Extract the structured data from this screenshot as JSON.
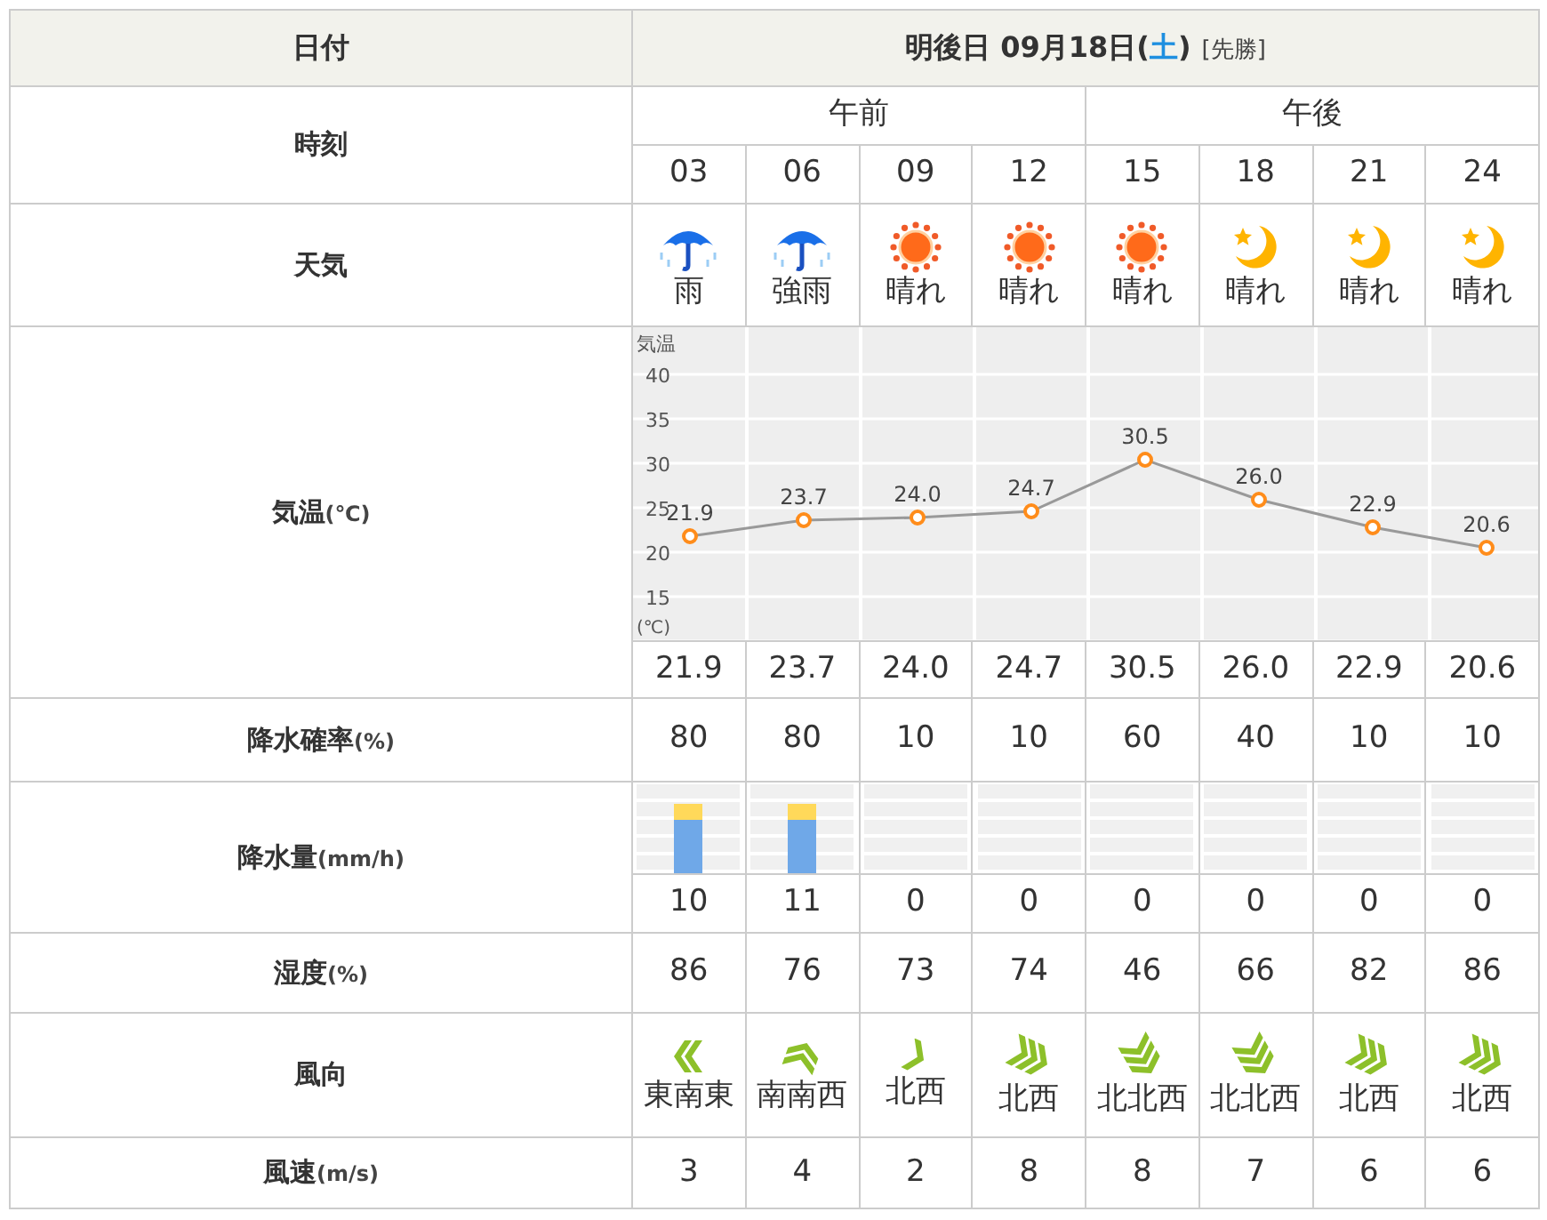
{
  "header": {
    "label": "日付",
    "date": "明後日 09月18日(",
    "weekday": "土",
    "date_end": ")",
    "rokuyo": "[先勝]"
  },
  "time_label": "時刻",
  "periods": [
    "午前",
    "午後"
  ],
  "hours": [
    "03",
    "06",
    "09",
    "12",
    "15",
    "18",
    "21",
    "24"
  ],
  "weather_label": "天気",
  "weather": [
    {
      "kind": "rain",
      "text": "雨"
    },
    {
      "kind": "rain",
      "text": "強雨"
    },
    {
      "kind": "sun",
      "text": "晴れ"
    },
    {
      "kind": "sun",
      "text": "晴れ"
    },
    {
      "kind": "sun",
      "text": "晴れ"
    },
    {
      "kind": "moon",
      "text": "晴れ"
    },
    {
      "kind": "moon",
      "text": "晴れ"
    },
    {
      "kind": "moon",
      "text": "晴れ"
    }
  ],
  "temperature": {
    "label": "気温",
    "unit": "(℃)",
    "chart_data": {
      "type": "line",
      "ylabel": "気温",
      "annotations": [
        "(℃)"
      ],
      "ylim": [
        10,
        45
      ],
      "yticks": [
        15,
        20,
        25,
        30,
        35,
        40
      ],
      "grid": true,
      "value_labels": [
        "21.9",
        "23.7",
        "24.0",
        "24.7",
        "30.5",
        "26.0",
        "22.9",
        "20.6"
      ],
      "series": [
        {
          "color": "#ff8c1a",
          "marker": "circle",
          "values": [
            21.9,
            23.7,
            24.0,
            24.7,
            30.5,
            26.0,
            22.9,
            20.6
          ]
        }
      ]
    },
    "values": [
      "21.9",
      "23.7",
      "24.0",
      "24.7",
      "30.5",
      "26.0",
      "22.9",
      "20.6"
    ]
  },
  "precip_prob": {
    "label": "降水確率",
    "unit": "(%)",
    "values": [
      "80",
      "80",
      "10",
      "10",
      "60",
      "40",
      "10",
      "10"
    ]
  },
  "precip_amount": {
    "label": "降水量",
    "unit": "(mm/h)",
    "values": [
      "10",
      "11",
      "0",
      "0",
      "0",
      "0",
      "0",
      "0"
    ]
  },
  "humidity": {
    "label": "湿度",
    "unit": "(%)",
    "values": [
      "86",
      "76",
      "73",
      "74",
      "46",
      "66",
      "82",
      "86"
    ]
  },
  "wind_direction": {
    "label": "風向",
    "items": [
      {
        "kind": "ese2",
        "text": "東南東"
      },
      {
        "kind": "ssw2",
        "text": "南南西"
      },
      {
        "kind": "nw1",
        "text": "北西"
      },
      {
        "kind": "nw3",
        "text": "北西"
      },
      {
        "kind": "nnw3",
        "text": "北北西"
      },
      {
        "kind": "nnw3",
        "text": "北北西"
      },
      {
        "kind": "nw3",
        "text": "北西"
      },
      {
        "kind": "nw3",
        "text": "北西"
      }
    ]
  },
  "wind_speed": {
    "label": "風速",
    "unit": "(m/s)",
    "values": [
      "3",
      "4",
      "2",
      "8",
      "8",
      "7",
      "6",
      "6"
    ]
  }
}
